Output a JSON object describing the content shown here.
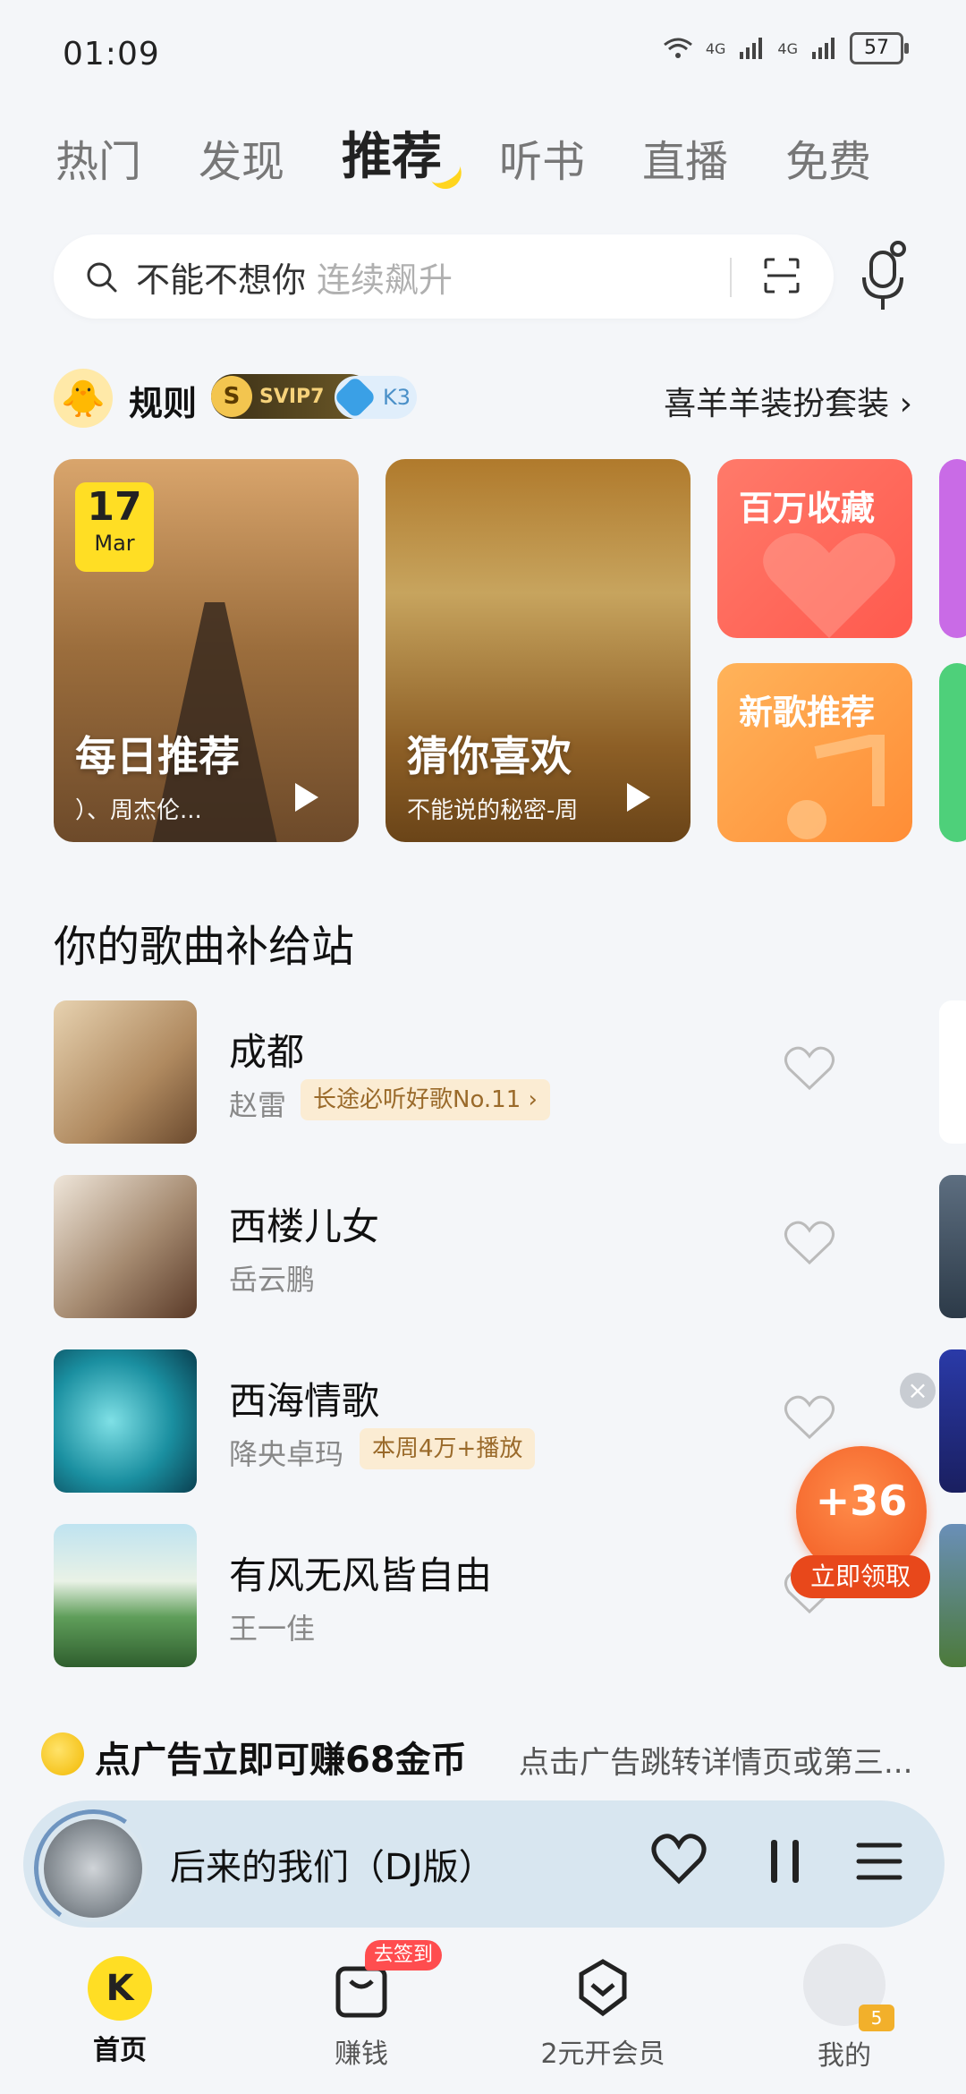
{
  "status_bar": {
    "time": "01:09",
    "battery": "57",
    "signal1": "4G",
    "signal2": "4G"
  },
  "tabs": [
    {
      "label": "热门"
    },
    {
      "label": "发现"
    },
    {
      "label": "推荐"
    },
    {
      "label": "听书"
    },
    {
      "label": "直播"
    },
    {
      "label": "免费"
    }
  ],
  "search": {
    "query": "不能不想你",
    "hint": "连续飙升"
  },
  "user": {
    "name": "规则",
    "svip": "SVIP7",
    "svip_level": "S",
    "k_level": "K3",
    "suit_link": "喜羊羊装扮套装"
  },
  "cards": {
    "daily": {
      "date_day": "17",
      "date_month": "Mar",
      "title": "每日推荐",
      "subtitle": "）、周杰伦..."
    },
    "guess": {
      "title": "猜你喜欢",
      "subtitle": "不能说的秘密-周"
    },
    "million": {
      "title": "百万收藏"
    },
    "new_songs": {
      "title": "新歌推荐"
    }
  },
  "section_title": "你的歌曲补给站",
  "songs": [
    {
      "title": "成都",
      "artist": "赵雷",
      "tag": "长途必听好歌No.11 ›"
    },
    {
      "title": "西楼儿女",
      "artist": "岳云鹏",
      "tag": ""
    },
    {
      "title": "西海情歌",
      "artist": "降央卓玛",
      "tag": "本周4万+播放"
    },
    {
      "title": "有风无风皆自由",
      "artist": "王一佳",
      "tag": ""
    }
  ],
  "reward": {
    "amount": "+36",
    "button": "立即领取"
  },
  "ad": {
    "title": "点广告立即可赚68金币",
    "desc": "点击广告跳转详情页或第三..."
  },
  "player": {
    "title": "后来的我们（DJ版）"
  },
  "nav": {
    "home": "首页",
    "earn": "赚钱",
    "earn_badge": "去签到",
    "vip": "2元开会员",
    "me": "我的",
    "me_level": "5"
  },
  "colors": {
    "accent": "#ffde24",
    "reward": "#f0561f",
    "player_bg": "#d8e6f0"
  }
}
